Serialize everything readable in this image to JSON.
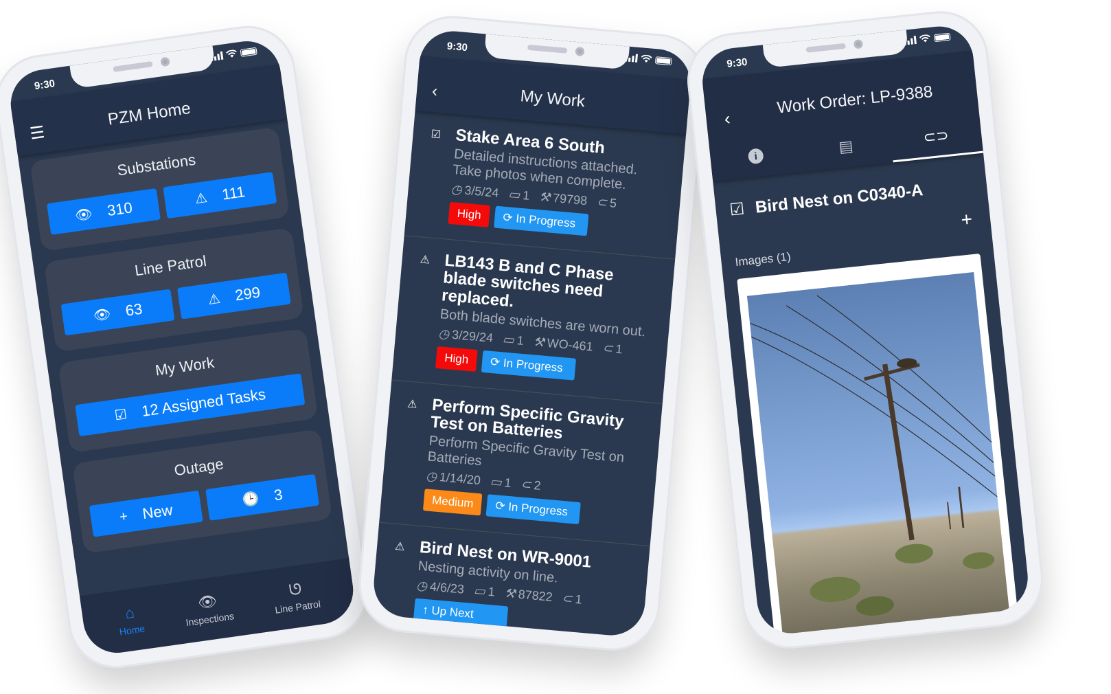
{
  "phones": [
    {
      "status_time": "9:30",
      "title": "PZM Home",
      "menu_icon": "hamburger-menu-icon",
      "cards": [
        {
          "title": "Substations",
          "buttons": [
            {
              "icon": "eye-icon",
              "value": "310"
            },
            {
              "icon": "warning-icon",
              "value": "111"
            }
          ]
        },
        {
          "title": "Line Patrol",
          "buttons": [
            {
              "icon": "eye-icon",
              "value": "63"
            },
            {
              "icon": "warning-icon",
              "value": "299"
            }
          ]
        },
        {
          "title": "My Work",
          "buttons": [
            {
              "icon": "checkbox-icon",
              "value": "12 Assigned Tasks"
            }
          ]
        },
        {
          "title": "Outage",
          "buttons": [
            {
              "icon": "plus-icon",
              "value": "New"
            },
            {
              "icon": "clock-icon",
              "value": "3"
            }
          ]
        }
      ],
      "tabs": [
        {
          "label": "Home",
          "icon": "home-icon",
          "active": true
        },
        {
          "label": "Inspections",
          "icon": "eye-icon",
          "active": false
        },
        {
          "label": "Line Patrol",
          "icon": "route-icon",
          "active": false
        }
      ]
    },
    {
      "status_time": "9:30",
      "title": "My Work",
      "back_icon": "chevron-left-icon",
      "items": [
        {
          "icon": "checkbox-icon",
          "title": "Stake Area 6 South",
          "description": "Detailed instructions attached. Take photos when complete.",
          "date": "3/5/24",
          "comments": "1",
          "work_order": "79798",
          "attachments": "5",
          "priority": "High",
          "status": "In Progress"
        },
        {
          "icon": "warning-icon",
          "title": "LB143 B and C Phase blade switches need replaced.",
          "description": "Both blade switches are worn out.",
          "date": "3/29/24",
          "comments": "1",
          "work_order": "WO-461",
          "attachments": "1",
          "priority": "High",
          "status": "In Progress"
        },
        {
          "icon": "warning-icon",
          "title": "Perform Specific Gravity Test on Batteries",
          "description": "Perform Specific Gravity Test on Batteries",
          "date": "1/14/20",
          "comments": "1",
          "work_order": "",
          "attachments": "2",
          "priority": "Medium",
          "status": "In Progress"
        },
        {
          "icon": "warning-icon",
          "title": "Bird Nest on WR-9001",
          "description": "Nesting activity on line.",
          "date": "4/6/23",
          "comments": "1",
          "work_order": "87822",
          "attachments": "1",
          "priority": "",
          "status": "Up Next"
        }
      ]
    },
    {
      "status_time": "9:30",
      "title": "Work Order: LP-9388",
      "back_icon": "chevron-left-icon",
      "tabs": [
        {
          "icon": "info-icon",
          "active": false
        },
        {
          "icon": "comment-icon",
          "active": false
        },
        {
          "icon": "paperclip-icon",
          "active": true
        }
      ],
      "task_title": "Bird Nest on C0340-A",
      "add_icon": "plus-icon",
      "images_label": "Images (1)",
      "image_description": "Utility pole with bird nest in desert landscape"
    }
  ],
  "colors": {
    "primary": "#0a7cf9",
    "status_blue": "#2196f3",
    "high": "#f50a0a",
    "medium": "#fb8a19",
    "background": "#2b3950",
    "card": "#3a4456",
    "appbar": "#24314a"
  }
}
